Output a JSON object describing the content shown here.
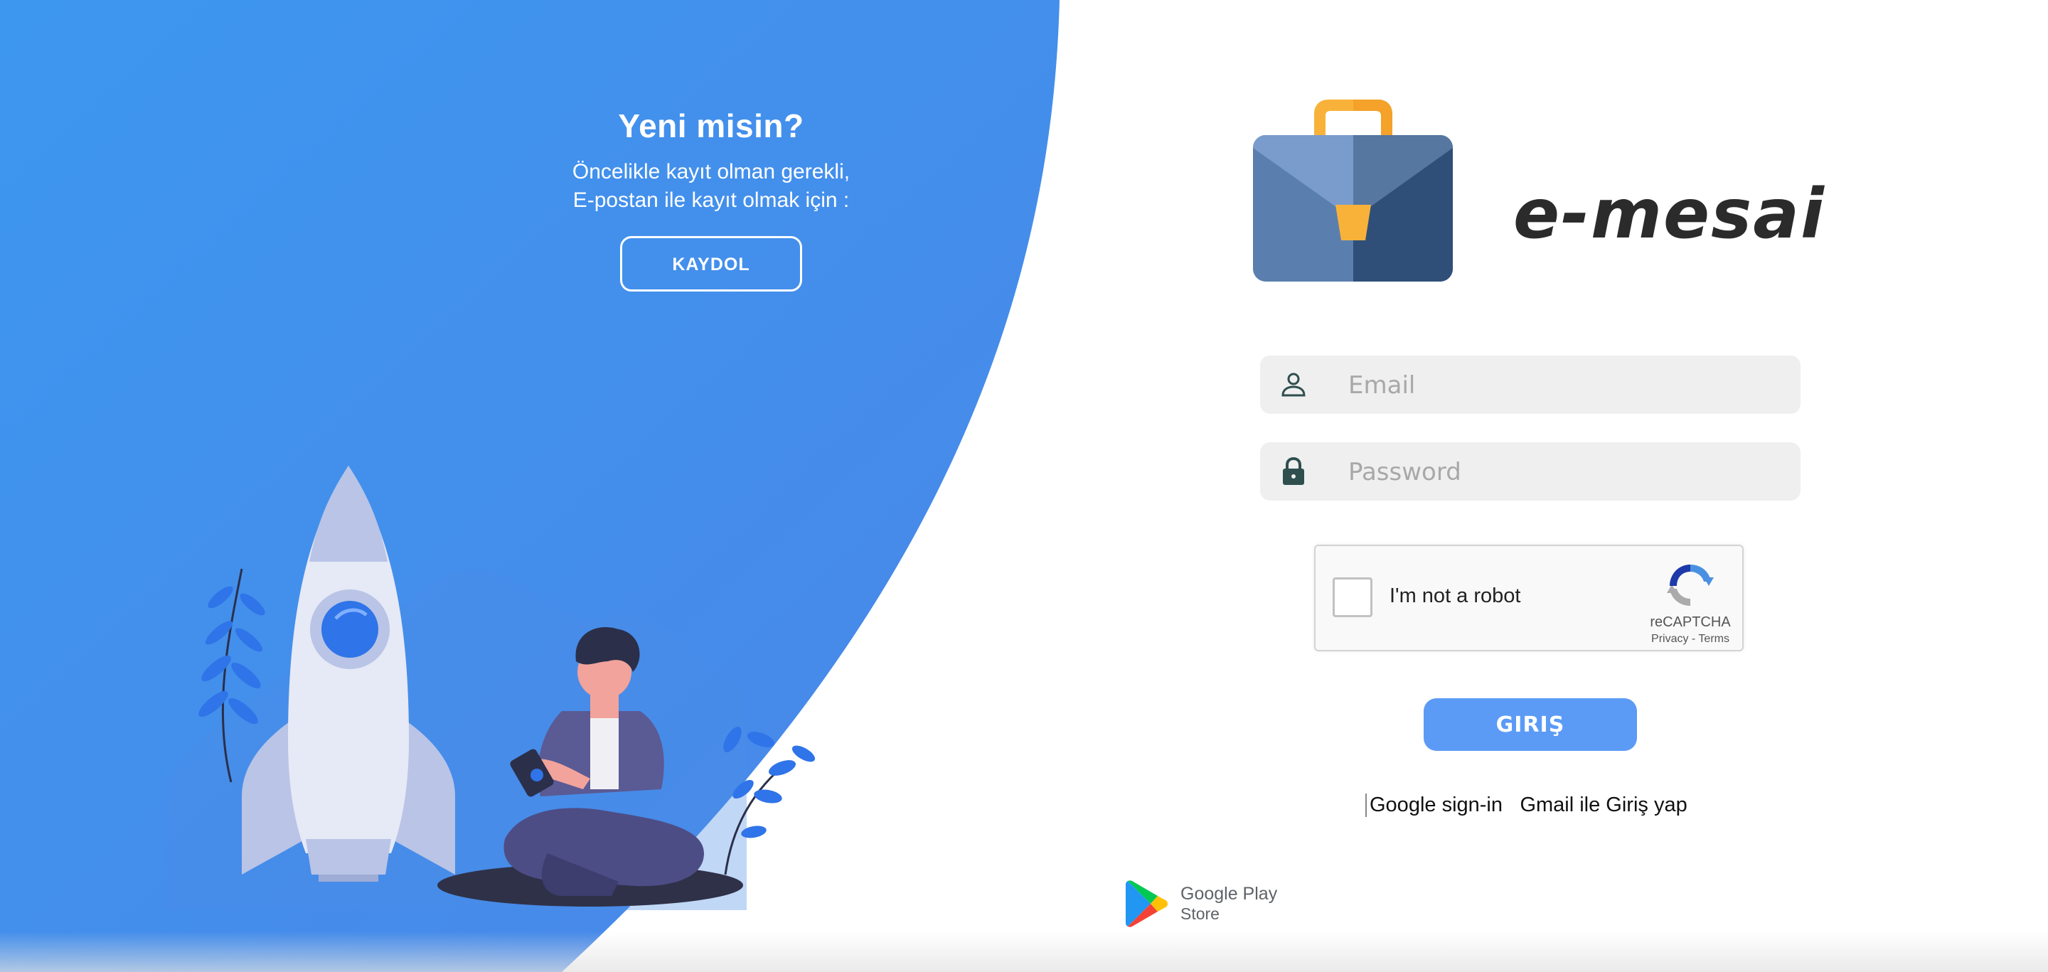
{
  "signup": {
    "title": "Yeni misin?",
    "line1": "Öncelikle kayıt olman gerekli,",
    "line2": "E-postan ile kayıt olmak için :",
    "button_label": "KAYDOL"
  },
  "brand": {
    "name": "e-mesai"
  },
  "login": {
    "email_placeholder": "Email",
    "password_placeholder": "Password",
    "button_label": "GIRIŞ"
  },
  "recaptcha": {
    "label": "I'm not a robot",
    "brand": "reCAPTCHA",
    "links": "Privacy - Terms"
  },
  "google": {
    "image_alt": "Google sign-in",
    "link_label": "Gmail ile Giriş yap"
  },
  "play_store": {
    "line1": "Google Play",
    "line2": "Store"
  },
  "colors": {
    "panel_blue": "#3f8fee",
    "login_button": "#5b9bf6",
    "input_bg": "#efefef",
    "icon_dark": "#2f4f4f"
  },
  "icons": {
    "email_field": "user-icon",
    "password_field": "lock-icon",
    "logo": "briefcase-icon",
    "store": "google-play-icon"
  }
}
